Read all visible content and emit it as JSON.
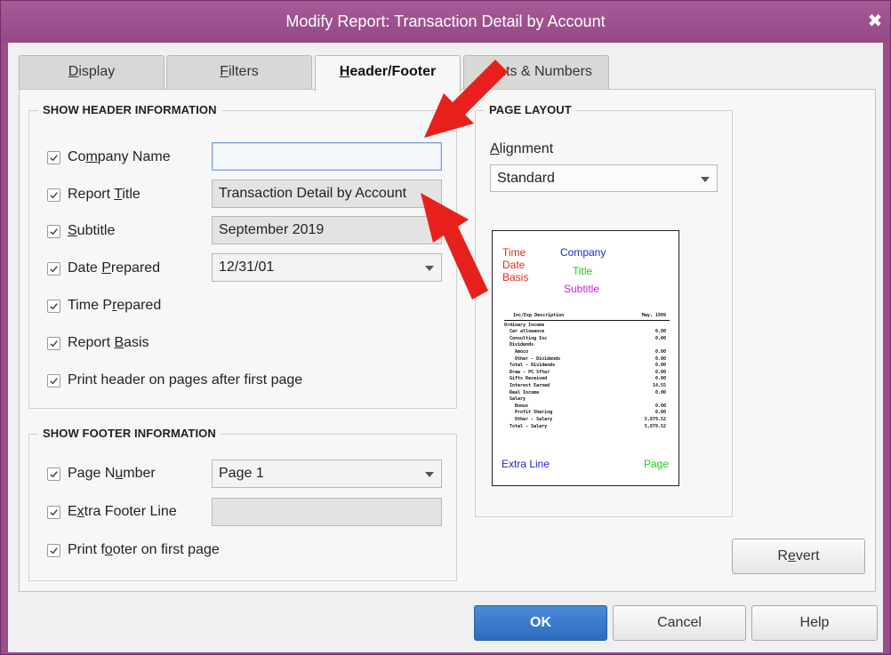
{
  "window": {
    "title": "Modify Report: Transaction Detail by Account",
    "close_glyph": "✖"
  },
  "tabs": [
    {
      "pre": "",
      "mnemonic": "D",
      "post": "isplay"
    },
    {
      "pre": "",
      "mnemonic": "F",
      "post": "ilters"
    },
    {
      "pre": "",
      "mnemonic": "H",
      "post": "eader/Footer"
    },
    {
      "pre": "",
      "mnemonic": "",
      "post": "nts & Numbers"
    }
  ],
  "header_section": {
    "title": "SHOW HEADER INFORMATION",
    "company_name": {
      "pre": "Co",
      "mnemonic": "m",
      "post": "pany Name",
      "value": ""
    },
    "report_title": {
      "pre": "Report ",
      "mnemonic": "T",
      "post": "itle",
      "value": "Transaction Detail by Account"
    },
    "subtitle": {
      "pre": "",
      "mnemonic": "S",
      "post": "ubtitle",
      "value": "September 2019"
    },
    "date_prepared": {
      "pre": "Date ",
      "mnemonic": "P",
      "post": "repared",
      "value": "12/31/01"
    },
    "time_prepared": {
      "pre": "Time P",
      "mnemonic": "r",
      "post": "epared"
    },
    "report_basis": {
      "pre": "Report ",
      "mnemonic": "B",
      "post": "asis"
    },
    "print_header": {
      "pre": "Print header on pa",
      "mnemonic": "g",
      "post": "es after first page"
    }
  },
  "footer_section": {
    "title": "SHOW FOOTER INFORMATION",
    "page_number": {
      "pre": "Page N",
      "mnemonic": "u",
      "post": "mber",
      "value": "Page 1"
    },
    "extra_footer": {
      "pre": "E",
      "mnemonic": "x",
      "post": "tra Footer Line",
      "value": ""
    },
    "print_footer": {
      "pre": "Print f",
      "mnemonic": "o",
      "post": "oter on first page"
    }
  },
  "page_layout": {
    "title": "PAGE LAYOUT",
    "alignment_label": {
      "pre": "",
      "mnemonic": "A",
      "post": "lignment"
    },
    "alignment_value": "Standard",
    "preview": {
      "time": "Time",
      "date": "Date",
      "basis": "Basis",
      "company": "Company",
      "title": "Title",
      "subtitle": "Subtitle",
      "extra_line": "Extra Line",
      "page": "Page",
      "colors": {
        "red": "#e8251f",
        "blue": "#2323d8",
        "green": "#22c922",
        "magenta": "#d11fd6"
      },
      "table_header": [
        "Inc/Exp Description",
        "May, 1999"
      ],
      "rows": [
        [
          "Ordinary Income",
          ""
        ],
        [
          "Car allowance",
          "0.00"
        ],
        [
          "Consulting Inc",
          "0.00"
        ],
        [
          "Dividends",
          ""
        ],
        [
          "Amoco",
          "0.00"
        ],
        [
          "Other - Dividends",
          "0.00"
        ],
        [
          "Total - Dividends",
          "0.00"
        ],
        [
          "Draw - PC Sftwr",
          "0.00"
        ],
        [
          "Gifts Received",
          "0.00"
        ],
        [
          "Interest Earned",
          "14.55"
        ],
        [
          "Real Income",
          "0.00"
        ],
        [
          "Salary",
          ""
        ],
        [
          "Bonus",
          "0.00"
        ],
        [
          "Profit Sharing",
          "0.00"
        ],
        [
          "Other - Salary",
          "5,879.52"
        ],
        [
          "Total - Salary",
          "5,879.52"
        ]
      ]
    }
  },
  "buttons": {
    "revert": {
      "pre": "R",
      "mnemonic": "e",
      "post": "vert"
    },
    "ok": "OK",
    "cancel": "Cancel",
    "help": "Help"
  },
  "colors": {
    "titlebar": "#9a4e8c",
    "annotation_arrow": "#e8201c",
    "ok_button": "#2d6cc0"
  }
}
